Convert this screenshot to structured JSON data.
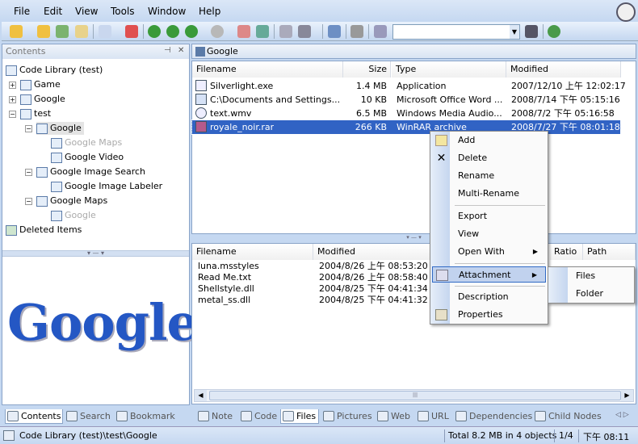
{
  "menu": [
    "File",
    "Edit",
    "View",
    "Tools",
    "Window",
    "Help"
  ],
  "left_panel": {
    "title": "Contents",
    "tree": [
      {
        "label": "Code Library (test)",
        "grey": false
      },
      {
        "label": "Game",
        "grey": false
      },
      {
        "label": "Google",
        "grey": false
      },
      {
        "label": "test",
        "grey": false
      },
      {
        "label": "Google",
        "grey": false
      },
      {
        "label": "Google Maps",
        "grey": true
      },
      {
        "label": "Google Video",
        "grey": false
      },
      {
        "label": "Google Image Search",
        "grey": false
      },
      {
        "label": "Google Image Labeler",
        "grey": false
      },
      {
        "label": "Google Maps",
        "grey": false
      },
      {
        "label": "Google",
        "grey": true
      },
      {
        "label": "Deleted Items",
        "grey": false
      }
    ],
    "logo_text": "Google"
  },
  "path_bar": "Google",
  "file_list": {
    "headers": [
      "Filename",
      "Size",
      "Type",
      "Modified"
    ],
    "rows": [
      {
        "name": "Silverlight.exe",
        "size": "1.4 MB",
        "type": "Application",
        "modified": "2007/12/10 上午 12:02:17"
      },
      {
        "name": "C:\\Documents and Settings...",
        "size": "10 KB",
        "type": "Microsoft Office Word ...",
        "modified": "2008/7/14 下午 05:15:16"
      },
      {
        "name": "text.wmv",
        "size": "6.5 MB",
        "type": "Windows Media Audio...",
        "modified": "2008/7/2 下午 05:16:58"
      },
      {
        "name": "royale_noir.rar",
        "size": "266 KB",
        "type": "WinRAR archive",
        "modified": "2008/7/27 下午 08:01:18"
      }
    ]
  },
  "archive_list": {
    "headers": [
      "Filename",
      "Modified",
      "Ratio",
      "Path"
    ],
    "rows": [
      {
        "name": "luna.msstyles",
        "modified": "2004/8/26 上午 08:53:20"
      },
      {
        "name": "Read Me.txt",
        "modified": "2004/8/26 上午 08:58:40"
      },
      {
        "name": "Shellstyle.dll",
        "modified": "2004/8/25 下午 04:41:34"
      },
      {
        "name": "metal_ss.dll",
        "modified": "2004/8/25 下午 04:41:32"
      }
    ]
  },
  "context_menu": {
    "items": [
      "Add",
      "Delete",
      "Rename",
      "Multi-Rename",
      "Export",
      "View",
      "Open With",
      "Attachment",
      "Description",
      "Properties"
    ],
    "submenu": [
      "Files",
      "Folder"
    ]
  },
  "left_tabs": [
    "Contents",
    "Search",
    "Bookmark"
  ],
  "right_tabs": [
    "Note",
    "Code",
    "Files",
    "Pictures",
    "Web",
    "URL",
    "Dependencies",
    "Child Nodes"
  ],
  "status": {
    "path": "Code Library (test)\\test\\Google",
    "total": "Total 8.2 MB in 4 objects",
    "page": "1/4",
    "time": "下午 08:11"
  }
}
